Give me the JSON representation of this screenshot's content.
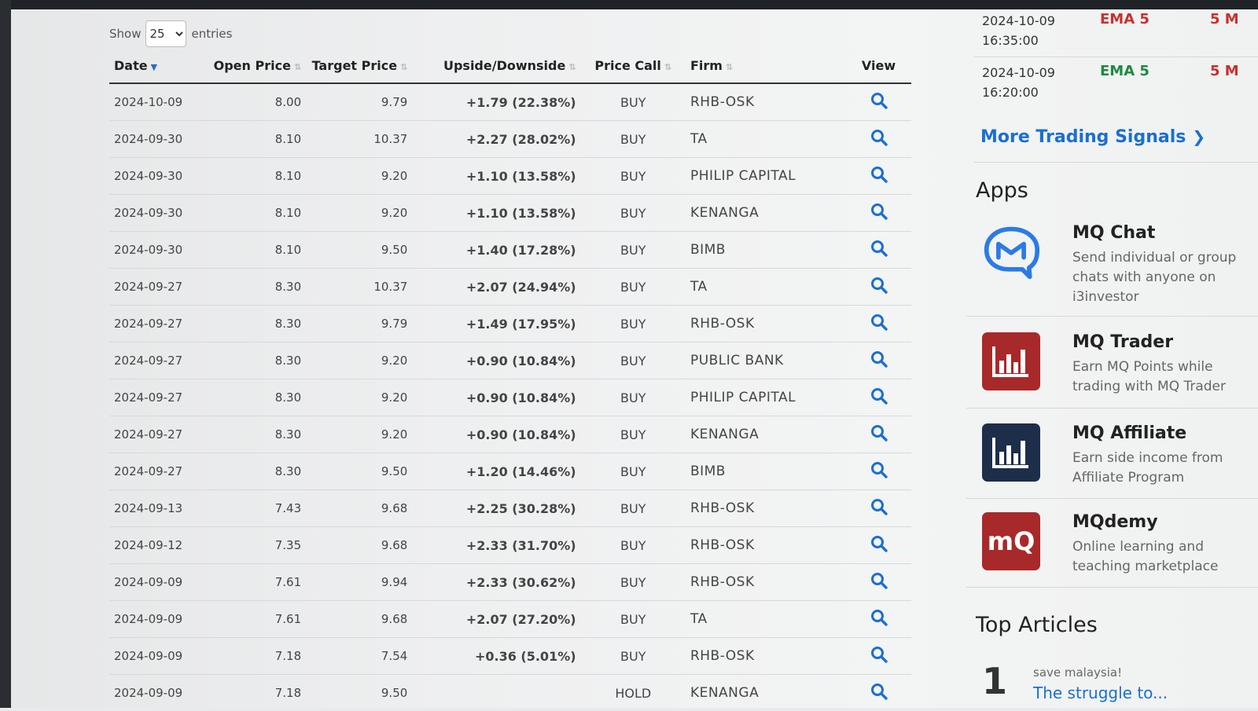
{
  "table": {
    "show_label": "Show",
    "entries_value": "25",
    "entries_label": "entries",
    "columns": {
      "date": "Date",
      "open": "Open Price",
      "target": "Target Price",
      "ud": "Upside/Downside",
      "call": "Price Call",
      "firm": "Firm",
      "view": "View"
    },
    "rows": [
      {
        "date": "2024-10-09",
        "open": "8.00",
        "target": "9.79",
        "ud": "+1.79 (22.38%)",
        "call": "BUY",
        "firm": "RHB-OSK"
      },
      {
        "date": "2024-09-30",
        "open": "8.10",
        "target": "10.37",
        "ud": "+2.27 (28.02%)",
        "call": "BUY",
        "firm": "TA"
      },
      {
        "date": "2024-09-30",
        "open": "8.10",
        "target": "9.20",
        "ud": "+1.10 (13.58%)",
        "call": "BUY",
        "firm": "PHILIP CAPITAL"
      },
      {
        "date": "2024-09-30",
        "open": "8.10",
        "target": "9.20",
        "ud": "+1.10 (13.58%)",
        "call": "BUY",
        "firm": "KENANGA"
      },
      {
        "date": "2024-09-30",
        "open": "8.10",
        "target": "9.50",
        "ud": "+1.40 (17.28%)",
        "call": "BUY",
        "firm": "BIMB"
      },
      {
        "date": "2024-09-27",
        "open": "8.30",
        "target": "10.37",
        "ud": "+2.07 (24.94%)",
        "call": "BUY",
        "firm": "TA"
      },
      {
        "date": "2024-09-27",
        "open": "8.30",
        "target": "9.79",
        "ud": "+1.49 (17.95%)",
        "call": "BUY",
        "firm": "RHB-OSK"
      },
      {
        "date": "2024-09-27",
        "open": "8.30",
        "target": "9.20",
        "ud": "+0.90 (10.84%)",
        "call": "BUY",
        "firm": "PUBLIC BANK"
      },
      {
        "date": "2024-09-27",
        "open": "8.30",
        "target": "9.20",
        "ud": "+0.90 (10.84%)",
        "call": "BUY",
        "firm": "PHILIP CAPITAL"
      },
      {
        "date": "2024-09-27",
        "open": "8.30",
        "target": "9.20",
        "ud": "+0.90 (10.84%)",
        "call": "BUY",
        "firm": "KENANGA"
      },
      {
        "date": "2024-09-27",
        "open": "8.30",
        "target": "9.50",
        "ud": "+1.20 (14.46%)",
        "call": "BUY",
        "firm": "BIMB"
      },
      {
        "date": "2024-09-13",
        "open": "7.43",
        "target": "9.68",
        "ud": "+2.25 (30.28%)",
        "call": "BUY",
        "firm": "RHB-OSK"
      },
      {
        "date": "2024-09-12",
        "open": "7.35",
        "target": "9.68",
        "ud": "+2.33 (31.70%)",
        "call": "BUY",
        "firm": "RHB-OSK"
      },
      {
        "date": "2024-09-09",
        "open": "7.61",
        "target": "9.94",
        "ud": "+2.33 (30.62%)",
        "call": "BUY",
        "firm": "RHB-OSK"
      },
      {
        "date": "2024-09-09",
        "open": "7.61",
        "target": "9.68",
        "ud": "+2.07 (27.20%)",
        "call": "BUY",
        "firm": "TA"
      },
      {
        "date": "2024-09-09",
        "open": "7.18",
        "target": "7.54",
        "ud": "+0.36 (5.01%)",
        "call": "BUY",
        "firm": "RHB-OSK"
      },
      {
        "date": "2024-09-09",
        "open": "7.18",
        "target": "9.50",
        "ud": "",
        "call": "HOLD",
        "firm": "KENANGA"
      }
    ]
  },
  "signals": [
    {
      "date": "2024-10-09",
      "time": "16:35:00",
      "indicator": "EMA 5",
      "timeframe": "5 M",
      "color": "#c9302c"
    },
    {
      "date": "2024-10-09",
      "time": "16:20:00",
      "indicator": "EMA 5",
      "timeframe": "5 M",
      "color": "#1e8a3e"
    }
  ],
  "more_signals_label": "More Trading Signals",
  "apps_title": "Apps",
  "apps": [
    {
      "name": "MQ Chat",
      "desc": "Send individual or group chats with anyone on i3investor",
      "icon": "chat-icon"
    },
    {
      "name": "MQ Trader",
      "desc": "Earn MQ Points while trading with MQ Trader",
      "icon": "bar-chart-icon"
    },
    {
      "name": "MQ Affiliate",
      "desc": "Earn side income from Affiliate Program",
      "icon": "bar-chart-icon"
    },
    {
      "name": "MQdemy",
      "desc": "Online learning and teaching marketplace",
      "icon": "mq-logo-icon",
      "icon_text": "mQ"
    }
  ],
  "top_articles_title": "Top Articles",
  "articles": [
    {
      "rank": "1",
      "source": "save malaysia!",
      "title": "The struggle to..."
    }
  ],
  "colors": {
    "positive": "#1e8a3e",
    "link": "#1a6fd1",
    "sell": "#c9302c",
    "trader_icon": "#a8292a",
    "affiliate_icon": "#1c2e4a",
    "mqdemy_icon": "#a8292a"
  }
}
